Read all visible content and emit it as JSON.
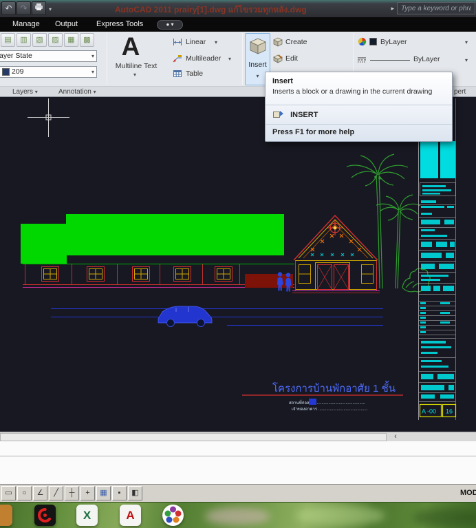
{
  "icons": {
    "chevron_down": "▾",
    "chevron_left": "‹",
    "chevron_right": "▸",
    "undo_arrow": "↶",
    "redo_arrow": "↷",
    "dot": "●"
  },
  "title_bar": {
    "app_title": "AutoCAD 2011    prairy[1].dwg แก้ไขรวมทุกหลัง.dwg",
    "search_placeholder": "Type a keyword or phras"
  },
  "menu_bar": {
    "items": [
      "Manage",
      "Output",
      "Express Tools"
    ]
  },
  "ribbon": {
    "layers_panel": {
      "label": "Layers",
      "state_value": "ayer State",
      "layer_value": "209",
      "tool_glyphs": [
        "▤",
        "▥",
        "▧",
        "▨",
        "▦",
        "▩"
      ]
    },
    "annotation_panel": {
      "label": "Annotation",
      "big_a": "A",
      "multiline_text": "Multiline Text",
      "linear": "Linear",
      "multileader": "Multileader",
      "table": "Table"
    },
    "block_panel": {
      "insert": "Insert",
      "create": "Create",
      "edit": "Edit"
    },
    "properties_panel": {
      "label_visible": "pert",
      "color_value": "ByLayer",
      "linetype_value": "ByLayer"
    }
  },
  "tooltip": {
    "title": "Insert",
    "description": "Inserts a block or a drawing in the current drawing",
    "command_name": "INSERT",
    "footer": "Press F1 for more help"
  },
  "drawing": {
    "project_title": "โครงการบ้านพักอาศัย 1 ชั้น",
    "note_line1": "สถานที่ก่อสร้าง ..........................................",
    "note_line2": "เจ้าของอาคาร ...........................................",
    "sheet_number": "A -00",
    "sheet_total": "16"
  },
  "status_toolbar": {
    "mode_label": "MOD",
    "buttons": [
      "▭",
      "○",
      "∠",
      "╱",
      "┼",
      "+",
      "▦",
      "▪",
      "◧"
    ]
  },
  "taskbar": {
    "excel_letter": "X",
    "autocad_letter": "A"
  },
  "colors": {
    "drawing_background": "#181822",
    "roof_green": "#00d800",
    "accent_cyan": "#00d8dc",
    "line_bl": "#2438d8",
    "frame_red": "#d43030",
    "frame_yellow": "#c8a000",
    "title_blue": "#4d6cff",
    "sheet_box_yellow": "#e0e000",
    "insert_highlight": "#d9e8f8"
  }
}
